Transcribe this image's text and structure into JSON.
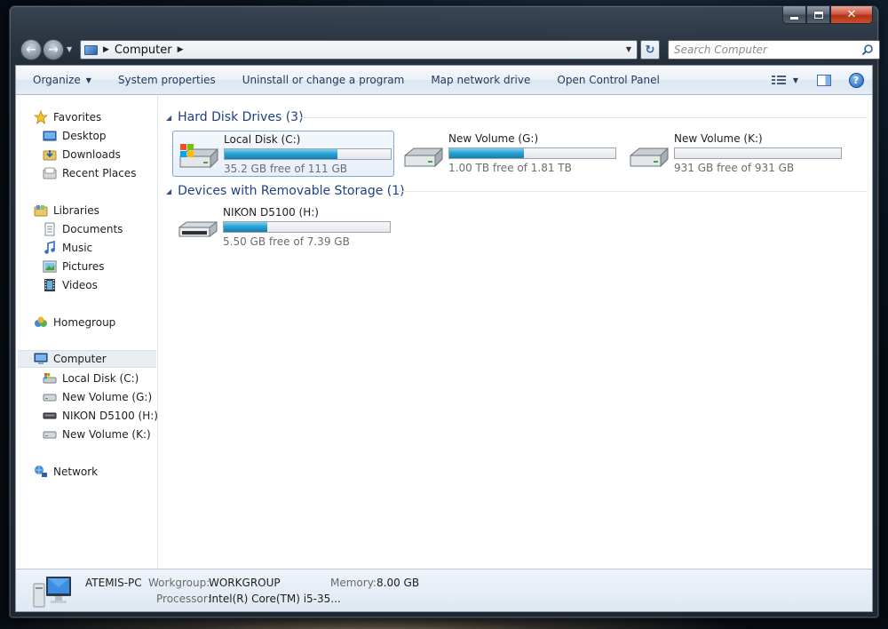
{
  "window": {
    "minimize_label": "Minimize",
    "maximize_label": "Maximize",
    "close_label": "✕"
  },
  "address": {
    "segments": [
      "Computer"
    ],
    "search_placeholder": "Search Computer"
  },
  "toolbar": {
    "organize": "Organize",
    "system_properties": "System properties",
    "uninstall": "Uninstall or change a program",
    "map_drive": "Map network drive",
    "control_panel": "Open Control Panel",
    "help": "?"
  },
  "sidebar": {
    "favorites": "Favorites",
    "desktop": "Desktop",
    "downloads": "Downloads",
    "recent_places": "Recent Places",
    "libraries": "Libraries",
    "documents": "Documents",
    "music": "Music",
    "pictures": "Pictures",
    "videos": "Videos",
    "homegroup": "Homegroup",
    "computer": "Computer",
    "local_disk": "Local Disk (C:)",
    "volume_g": "New Volume (G:)",
    "nikon": "NIKON D5100 (H:)",
    "volume_k": "New Volume (K:)",
    "network": "Network"
  },
  "groups": {
    "hard_disks": "Hard Disk Drives (3)",
    "removable": "Devices with Removable Storage (1)"
  },
  "drives": [
    {
      "name": "Local Disk (C:)",
      "free": "35.2 GB free of 111 GB",
      "used_fraction": 0.68
    },
    {
      "name": "New Volume (G:)",
      "free": "1.00 TB free of 1.81 TB",
      "used_fraction": 0.45
    },
    {
      "name": "New Volume (K:)",
      "free": "931 GB free of 931 GB",
      "used_fraction": 0.0
    },
    {
      "name": "NIKON D5100 (H:)",
      "free": "5.50 GB free of 7.39 GB",
      "used_fraction": 0.26
    }
  ],
  "details": {
    "computer_name": "ATEMIS-PC",
    "workgroup_label": "Workgroup:",
    "workgroup_value": "WORKGROUP",
    "memory_label": "Memory:",
    "memory_value": "8.00 GB",
    "processor_label": "Processor:",
    "processor_value": "Intel(R) Core(TM) i5-35..."
  },
  "colors": {
    "accent_blue": "#1f3f82",
    "bar_fill": "#28a4d4",
    "toolbar_text": "#1e395b"
  }
}
